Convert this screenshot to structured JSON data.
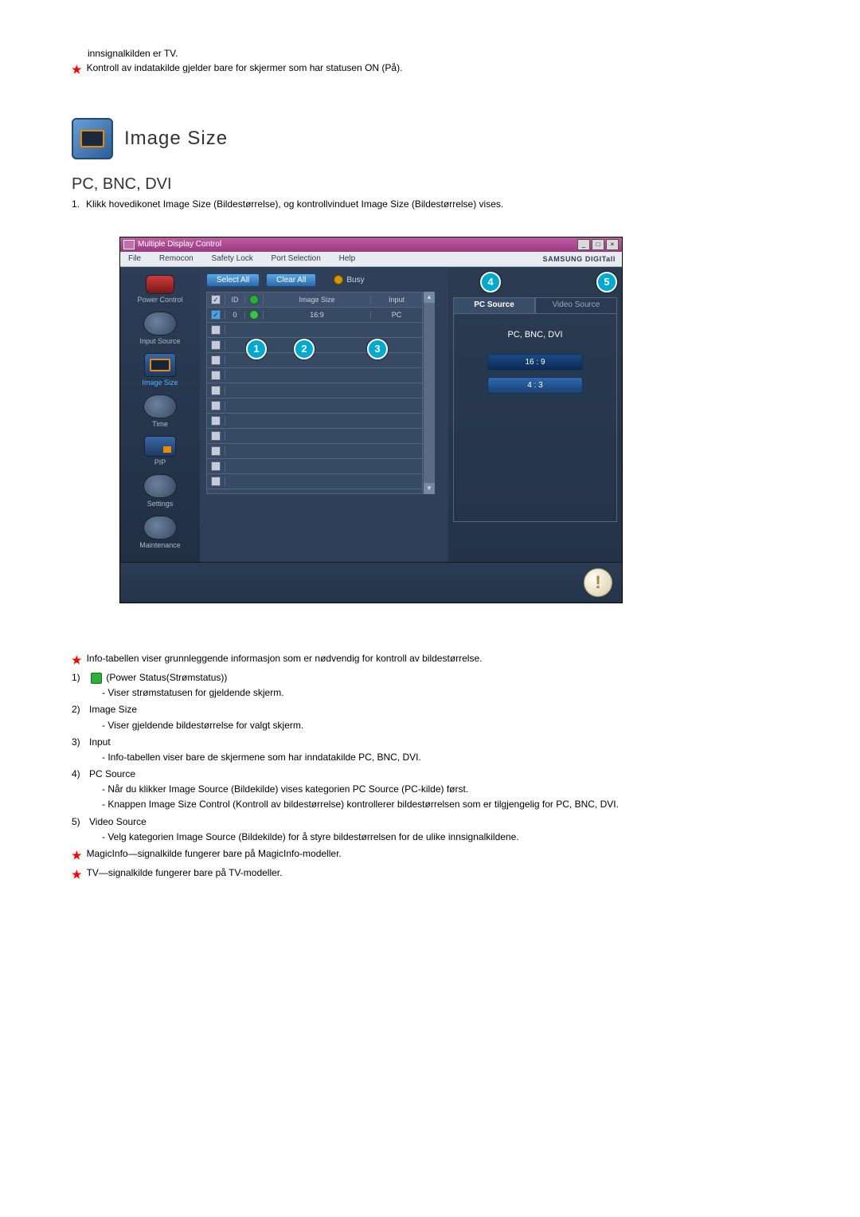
{
  "intro": {
    "line_plain": "innsignalkilden er TV.",
    "line_star": "Kontroll av indatakilde gjelder bare for skjermer som har statusen ON (På)."
  },
  "section": {
    "title": "Image Size",
    "subtitle": "PC, BNC, DVI",
    "step1": "Klikk hovedikonet Image Size (Bildestørrelse), og kontrollvinduet Image Size (Bildestørrelse) vises."
  },
  "app": {
    "title": "Multiple Display Control",
    "menu": [
      "File",
      "Remocon",
      "Safety Lock",
      "Port Selection",
      "Help"
    ],
    "brand": "SAMSUNG DIGITall",
    "sidebar": [
      "Power Control",
      "Input Source",
      "Image Size",
      "Time",
      "PIP",
      "Settings",
      "Maintenance"
    ],
    "buttons": {
      "select_all": "Select All",
      "clear_all": "Clear All",
      "busy": "Busy"
    },
    "grid": {
      "headers": {
        "chk": "☑",
        "id": "ID",
        "pwr": "",
        "size": "Image Size",
        "input": "Input"
      },
      "row": {
        "id": "0",
        "size": "16:9",
        "input": "PC"
      }
    },
    "rightpane": {
      "tab_pc": "PC Source",
      "tab_video": "Video Source",
      "group_title": "PC, BNC, DVI",
      "opt1": "16 : 9",
      "opt2": "4 : 3"
    },
    "annot": {
      "n1": "1",
      "n2": "2",
      "n3": "3",
      "n4": "4",
      "n5": "5"
    }
  },
  "info": {
    "starA": "Info-tabellen viser grunnleggende informasjon som er nødvendig for kontroll av bildestørrelse.",
    "i1_label": "1)",
    "i1_title": "(Power Status(Strømstatus))",
    "i1_sub": "- Viser strømstatusen for gjeldende skjerm.",
    "i2_label": "2)",
    "i2_title": "Image Size",
    "i2_sub": "- Viser gjeldende bildestørrelse for valgt skjerm.",
    "i3_label": "3)",
    "i3_title": "Input",
    "i3_sub": "- Info-tabellen viser bare de skjermene som har inndatakilde PC, BNC, DVI.",
    "i4_label": "4)",
    "i4_title": "PC Source",
    "i4_sub1": "- Når du klikker Image Source (Bildekilde) vises kategorien PC Source (PC-kilde) først.",
    "i4_sub2": "- Knappen Image Size Control (Kontroll av bildestørrelse) kontrollerer bildestørrelsen som er tilgjengelig for PC, BNC, DVI.",
    "i5_label": "5)",
    "i5_title": "Video Source",
    "i5_sub": "- Velg kategorien Image Source (Bildekilde) for å styre bildestørrelsen for de ulike innsignalkildene.",
    "starB": "MagicInfo—signalkilde fungerer bare på MagicInfo-modeller.",
    "starC": "TV—signalkilde fungerer bare på TV-modeller."
  }
}
